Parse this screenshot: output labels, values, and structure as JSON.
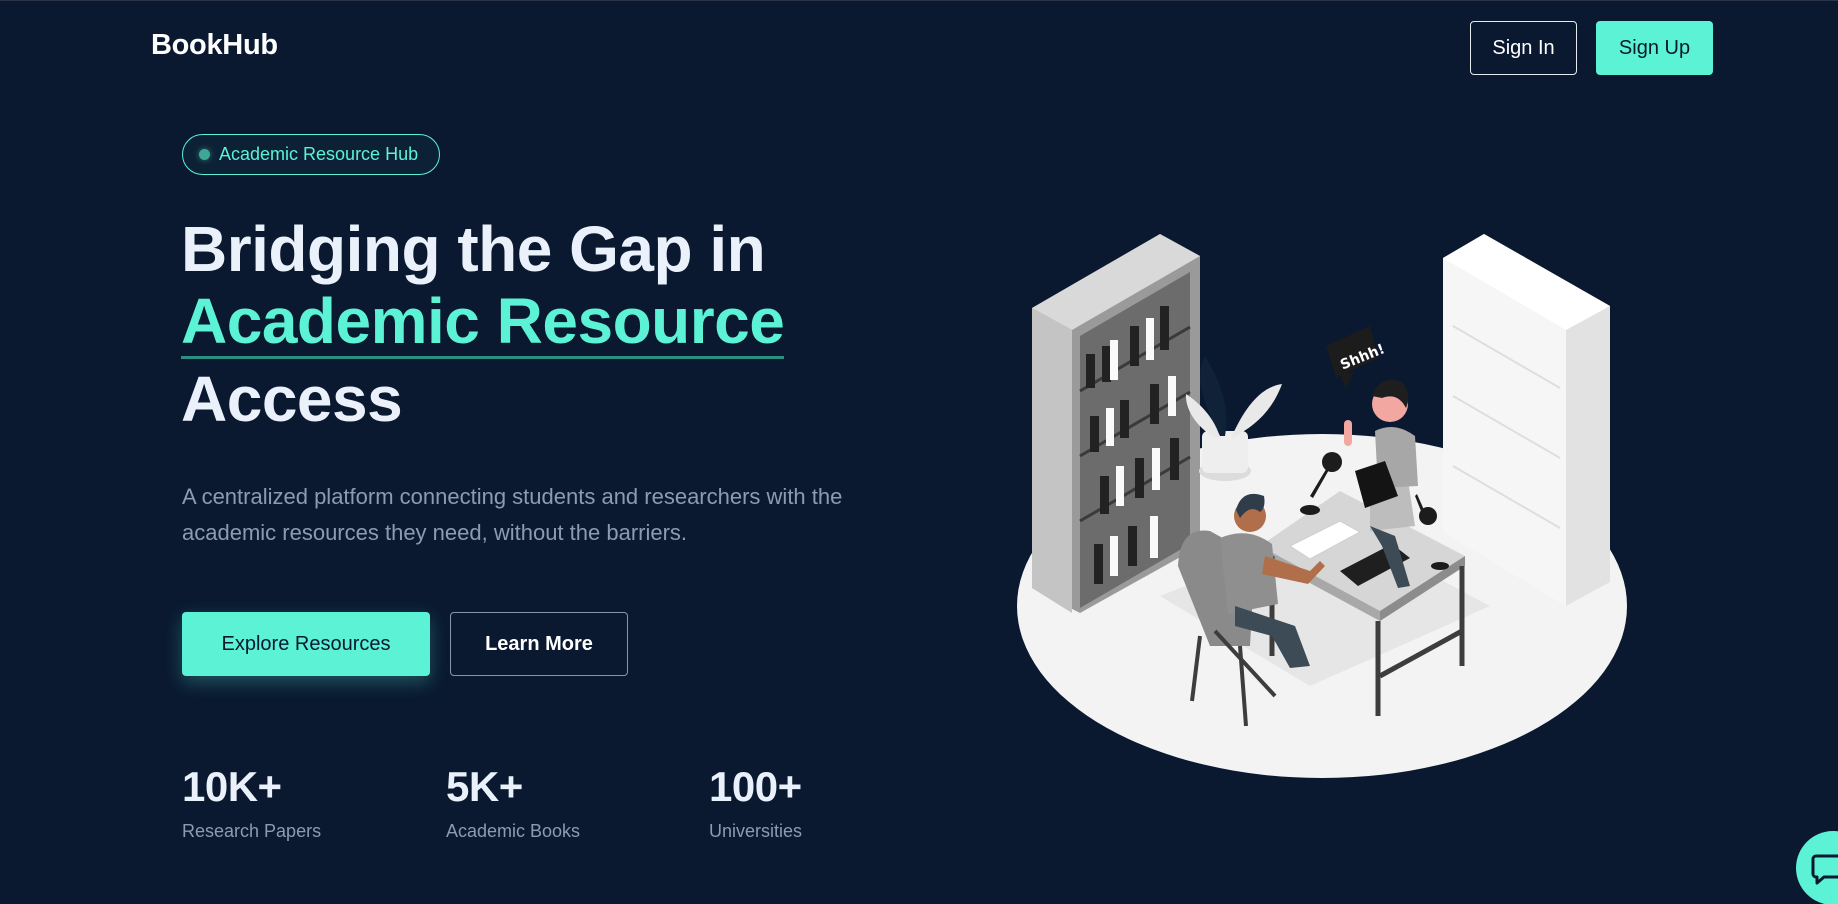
{
  "header": {
    "logo": "BookHub",
    "sign_in_label": "Sign In",
    "sign_up_label": "Sign Up"
  },
  "hero": {
    "badge": "Academic Resource Hub",
    "headline_line1": "Bridging the Gap in",
    "headline_line2": "Academic Resource",
    "headline_line3": "Access",
    "subtitle": "A centralized platform connecting students and researchers with the academic resources they need, without the barriers.",
    "primary_cta": "Explore Resources",
    "secondary_cta": "Learn More",
    "illustration_speech_text": "Shhh!"
  },
  "stats": [
    {
      "value": "10K+",
      "label": "Research Papers"
    },
    {
      "value": "5K+",
      "label": "Academic Books"
    },
    {
      "value": "100+",
      "label": "Universities"
    }
  ],
  "chat": {
    "icon": "chat-bubble-icon"
  },
  "colors": {
    "background": "#0a1930",
    "accent": "#5cf2d6",
    "muted_text": "#8e9ab4"
  }
}
